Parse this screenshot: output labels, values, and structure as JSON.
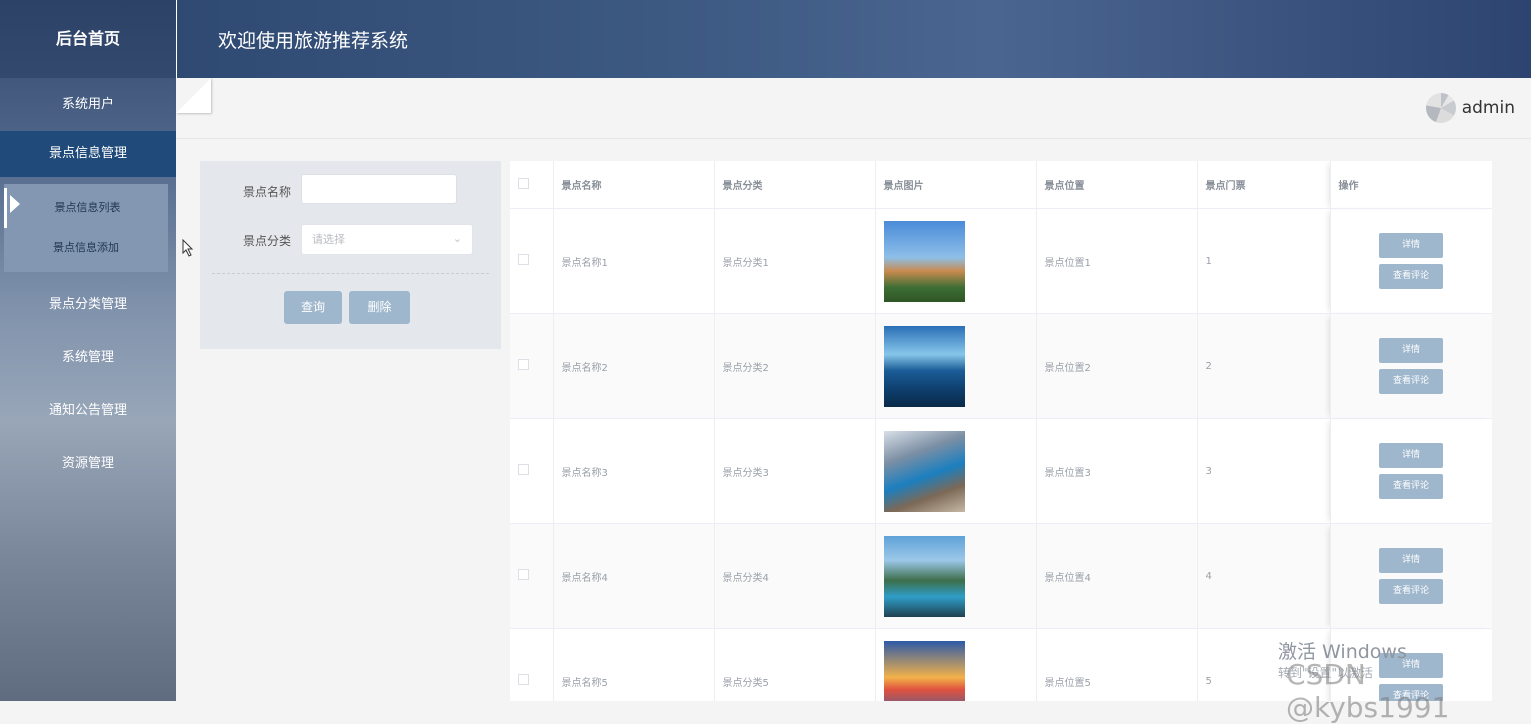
{
  "sidebar": {
    "brand": "后台首页",
    "items": [
      {
        "label": "系统用户"
      },
      {
        "label": "景点信息管理"
      },
      {
        "label": "景点分类管理"
      },
      {
        "label": "系统管理"
      },
      {
        "label": "通知公告管理"
      },
      {
        "label": "资源管理"
      }
    ],
    "submenu": [
      {
        "label": "景点信息列表"
      },
      {
        "label": "景点信息添加"
      }
    ]
  },
  "header": {
    "title": "欢迎使用旅游推荐系统"
  },
  "user": {
    "name": "admin"
  },
  "search": {
    "name_label": "景点名称",
    "name_value": "",
    "category_label": "景点分类",
    "category_placeholder": "请选择",
    "query_button": "查询",
    "delete_button": "删除"
  },
  "table": {
    "headers": [
      "景点名称",
      "景点分类",
      "景点图片",
      "景点位置",
      "景点门票",
      "操作"
    ],
    "rows": [
      {
        "name": "景点名称1",
        "category": "景点分类1",
        "location": "景点位置1",
        "ticket": "1"
      },
      {
        "name": "景点名称2",
        "category": "景点分类2",
        "location": "景点位置2",
        "ticket": "2"
      },
      {
        "name": "景点名称3",
        "category": "景点分类3",
        "location": "景点位置3",
        "ticket": "3"
      },
      {
        "name": "景点名称4",
        "category": "景点分类4",
        "location": "景点位置4",
        "ticket": "4"
      },
      {
        "name": "景点名称5",
        "category": "景点分类5",
        "location": "景点位置5",
        "ticket": "5"
      }
    ],
    "detail_button": "详情",
    "comment_button": "查看评论"
  },
  "watermark": {
    "line1": "激活 Windows",
    "line2": "转到\"设置\"以激活",
    "csdn": "CSDN @kybs1991"
  },
  "colors": {
    "sidebar_active": "#1f4a7a",
    "header": "#3e5b84",
    "button": "#9fb7cd"
  }
}
